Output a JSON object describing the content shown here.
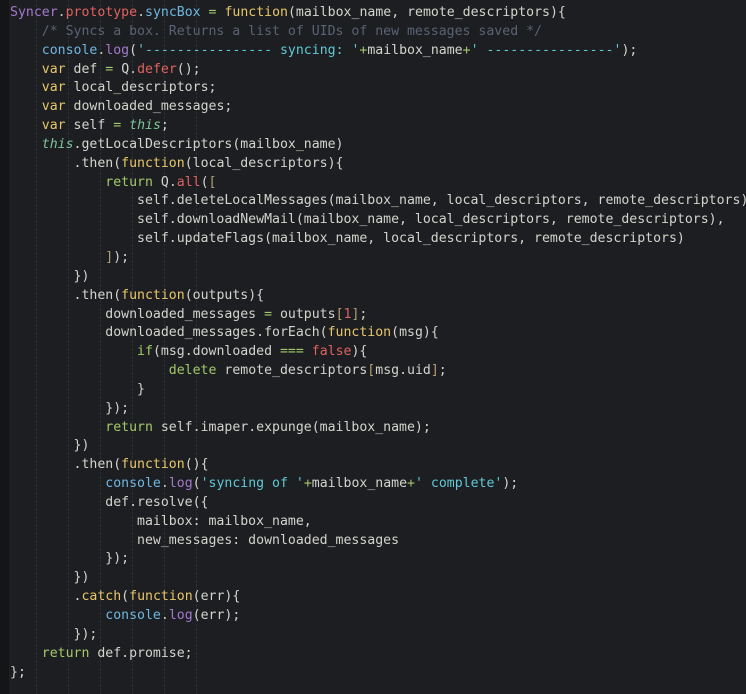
{
  "editor": {
    "language": "javascript",
    "theme_name": "dark",
    "colors": {
      "background": "#1c1e21",
      "gutter": "#141517",
      "default_text": "#d4d4cd",
      "class_name": "#a37acc",
      "property": "#e0625f",
      "function_name": "#6fb7e0",
      "keyword": "#e8c76a",
      "operator": "#a3c96a",
      "this_keyword": "#7ec699",
      "string": "#5fc9d6",
      "comment": "#5a6374",
      "number": "#e0625f",
      "bracket": "#b5a070"
    },
    "total_lines": 37
  },
  "code_lines": [
    {
      "n": 1,
      "tokens": [
        {
          "t": "Syncer",
          "c": "t-cls"
        },
        {
          "t": ".",
          "c": "t-pun"
        },
        {
          "t": "prototype",
          "c": "t-prop"
        },
        {
          "t": ".",
          "c": "t-pun"
        },
        {
          "t": "syncBox",
          "c": "t-fn"
        },
        {
          "t": " ",
          "c": "t-def"
        },
        {
          "t": "=",
          "c": "t-op"
        },
        {
          "t": " ",
          "c": "t-def"
        },
        {
          "t": "function",
          "c": "t-kw"
        },
        {
          "t": "(mailbox_name, remote_descriptors){",
          "c": "t-def"
        }
      ]
    },
    {
      "n": 2,
      "tokens": [
        {
          "t": "    /* Syncs a box. Returns a list of UIDs of new messages saved */",
          "c": "t-com"
        }
      ]
    },
    {
      "n": 3,
      "tokens": [
        {
          "t": "    ",
          "c": "t-def"
        },
        {
          "t": "console",
          "c": "t-blue"
        },
        {
          "t": ".",
          "c": "t-pun"
        },
        {
          "t": "log",
          "c": "t-purp"
        },
        {
          "t": "(",
          "c": "t-def"
        },
        {
          "t": "'---------------- syncing: '",
          "c": "t-str"
        },
        {
          "t": "+",
          "c": "t-op"
        },
        {
          "t": "mailbox_name",
          "c": "t-def"
        },
        {
          "t": "+",
          "c": "t-op"
        },
        {
          "t": "' ----------------'",
          "c": "t-str"
        },
        {
          "t": ");",
          "c": "t-def"
        }
      ]
    },
    {
      "n": 4,
      "tokens": [
        {
          "t": "    ",
          "c": "t-def"
        },
        {
          "t": "var",
          "c": "t-kw"
        },
        {
          "t": " def ",
          "c": "t-def"
        },
        {
          "t": "=",
          "c": "t-op"
        },
        {
          "t": " Q",
          "c": "t-def"
        },
        {
          "t": ".",
          "c": "t-pun"
        },
        {
          "t": "defer",
          "c": "t-prop"
        },
        {
          "t": "();",
          "c": "t-def"
        }
      ]
    },
    {
      "n": 5,
      "tokens": [
        {
          "t": "    ",
          "c": "t-def"
        },
        {
          "t": "var",
          "c": "t-kw"
        },
        {
          "t": " local_descriptors;",
          "c": "t-def"
        }
      ]
    },
    {
      "n": 6,
      "tokens": [
        {
          "t": "    ",
          "c": "t-def"
        },
        {
          "t": "var",
          "c": "t-kw"
        },
        {
          "t": " downloaded_messages;",
          "c": "t-def"
        }
      ]
    },
    {
      "n": 7,
      "tokens": [
        {
          "t": "    ",
          "c": "t-def"
        },
        {
          "t": "var",
          "c": "t-kw"
        },
        {
          "t": " self ",
          "c": "t-def"
        },
        {
          "t": "=",
          "c": "t-op"
        },
        {
          "t": " ",
          "c": "t-def"
        },
        {
          "t": "this",
          "c": "t-this"
        },
        {
          "t": ";",
          "c": "t-def"
        }
      ]
    },
    {
      "n": 8,
      "tokens": [
        {
          "t": "    ",
          "c": "t-def"
        },
        {
          "t": "this",
          "c": "t-this"
        },
        {
          "t": ".getLocalDescriptors(mailbox_name)",
          "c": "t-def"
        }
      ]
    },
    {
      "n": 9,
      "tokens": [
        {
          "t": "        .then(",
          "c": "t-def"
        },
        {
          "t": "function",
          "c": "t-kw"
        },
        {
          "t": "(local_descriptors){",
          "c": "t-def"
        }
      ]
    },
    {
      "n": 10,
      "tokens": [
        {
          "t": "            ",
          "c": "t-def"
        },
        {
          "t": "return",
          "c": "t-ret"
        },
        {
          "t": " Q",
          "c": "t-def"
        },
        {
          "t": ".",
          "c": "t-pun"
        },
        {
          "t": "all",
          "c": "t-prop"
        },
        {
          "t": "(",
          "c": "t-def"
        },
        {
          "t": "[",
          "c": "t-brk"
        }
      ]
    },
    {
      "n": 11,
      "tokens": [
        {
          "t": "                self.deleteLocalMessages(mailbox_name, local_descriptors, remote_descriptors),",
          "c": "t-def"
        }
      ]
    },
    {
      "n": 12,
      "tokens": [
        {
          "t": "                self.downloadNewMail(mailbox_name, local_descriptors, remote_descriptors),",
          "c": "t-def"
        }
      ]
    },
    {
      "n": 13,
      "tokens": [
        {
          "t": "                self.updateFlags(mailbox_name, local_descriptors, remote_descriptors)",
          "c": "t-def"
        }
      ]
    },
    {
      "n": 14,
      "tokens": [
        {
          "t": "            ",
          "c": "t-def"
        },
        {
          "t": "]",
          "c": "t-brk"
        },
        {
          "t": ");",
          "c": "t-def"
        }
      ]
    },
    {
      "n": 15,
      "tokens": [
        {
          "t": "        })",
          "c": "t-def"
        }
      ]
    },
    {
      "n": 16,
      "tokens": [
        {
          "t": "        .then(",
          "c": "t-def"
        },
        {
          "t": "function",
          "c": "t-kw"
        },
        {
          "t": "(outputs){",
          "c": "t-def"
        }
      ]
    },
    {
      "n": 17,
      "tokens": [
        {
          "t": "            downloaded_messages ",
          "c": "t-def"
        },
        {
          "t": "=",
          "c": "t-op"
        },
        {
          "t": " outputs",
          "c": "t-def"
        },
        {
          "t": "[",
          "c": "t-brk"
        },
        {
          "t": "1",
          "c": "t-num"
        },
        {
          "t": "]",
          "c": "t-brk"
        },
        {
          "t": ";",
          "c": "t-def"
        }
      ]
    },
    {
      "n": 18,
      "tokens": [
        {
          "t": "            downloaded_messages.forEach(",
          "c": "t-def"
        },
        {
          "t": "function",
          "c": "t-kw"
        },
        {
          "t": "(msg){",
          "c": "t-def"
        }
      ]
    },
    {
      "n": 19,
      "tokens": [
        {
          "t": "                ",
          "c": "t-def"
        },
        {
          "t": "if",
          "c": "t-ret"
        },
        {
          "t": "(msg.downloaded ",
          "c": "t-def"
        },
        {
          "t": "===",
          "c": "t-op"
        },
        {
          "t": " ",
          "c": "t-def"
        },
        {
          "t": "false",
          "c": "t-num"
        },
        {
          "t": "){",
          "c": "t-def"
        }
      ]
    },
    {
      "n": 20,
      "tokens": [
        {
          "t": "                    ",
          "c": "t-def"
        },
        {
          "t": "delete",
          "c": "t-ret"
        },
        {
          "t": " remote_descriptors",
          "c": "t-def"
        },
        {
          "t": "[",
          "c": "t-brk"
        },
        {
          "t": "msg.uid",
          "c": "t-def"
        },
        {
          "t": "]",
          "c": "t-brk"
        },
        {
          "t": ";",
          "c": "t-def"
        }
      ]
    },
    {
      "n": 21,
      "tokens": [
        {
          "t": "                }",
          "c": "t-def"
        }
      ]
    },
    {
      "n": 22,
      "tokens": [
        {
          "t": "            });",
          "c": "t-def"
        }
      ]
    },
    {
      "n": 23,
      "tokens": [
        {
          "t": "            ",
          "c": "t-def"
        },
        {
          "t": "return",
          "c": "t-ret"
        },
        {
          "t": " self.imaper.expunge(mailbox_name);",
          "c": "t-def"
        }
      ]
    },
    {
      "n": 24,
      "tokens": [
        {
          "t": "        })",
          "c": "t-def"
        }
      ]
    },
    {
      "n": 25,
      "tokens": [
        {
          "t": "        .then(",
          "c": "t-def"
        },
        {
          "t": "function",
          "c": "t-kw"
        },
        {
          "t": "(){",
          "c": "t-def"
        }
      ]
    },
    {
      "n": 26,
      "tokens": [
        {
          "t": "            ",
          "c": "t-def"
        },
        {
          "t": "console",
          "c": "t-blue"
        },
        {
          "t": ".",
          "c": "t-pun"
        },
        {
          "t": "log",
          "c": "t-purp"
        },
        {
          "t": "(",
          "c": "t-def"
        },
        {
          "t": "'syncing of '",
          "c": "t-str"
        },
        {
          "t": "+",
          "c": "t-op"
        },
        {
          "t": "mailbox_name",
          "c": "t-def"
        },
        {
          "t": "+",
          "c": "t-op"
        },
        {
          "t": "' complete'",
          "c": "t-str"
        },
        {
          "t": ");",
          "c": "t-def"
        }
      ]
    },
    {
      "n": 27,
      "tokens": [
        {
          "t": "            def.resolve({",
          "c": "t-def"
        }
      ]
    },
    {
      "n": 28,
      "tokens": [
        {
          "t": "                mailbox: mailbox_name,",
          "c": "t-def"
        }
      ]
    },
    {
      "n": 29,
      "tokens": [
        {
          "t": "                new_messages: downloaded_messages",
          "c": "t-def"
        }
      ]
    },
    {
      "n": 30,
      "tokens": [
        {
          "t": "            });",
          "c": "t-def"
        }
      ]
    },
    {
      "n": 31,
      "tokens": [
        {
          "t": "        })",
          "c": "t-def"
        }
      ]
    },
    {
      "n": 32,
      "tokens": [
        {
          "t": "        .",
          "c": "t-def"
        },
        {
          "t": "catch",
          "c": "t-meth"
        },
        {
          "t": "(",
          "c": "t-def"
        },
        {
          "t": "function",
          "c": "t-kw"
        },
        {
          "t": "(err){",
          "c": "t-def"
        }
      ]
    },
    {
      "n": 33,
      "tokens": [
        {
          "t": "            ",
          "c": "t-def"
        },
        {
          "t": "console",
          "c": "t-blue"
        },
        {
          "t": ".",
          "c": "t-pun"
        },
        {
          "t": "log",
          "c": "t-purp"
        },
        {
          "t": "(err);",
          "c": "t-def"
        }
      ]
    },
    {
      "n": 34,
      "tokens": [
        {
          "t": "        });",
          "c": "t-def"
        }
      ]
    },
    {
      "n": 35,
      "tokens": [
        {
          "t": "    ",
          "c": "t-def"
        },
        {
          "t": "return",
          "c": "t-ret"
        },
        {
          "t": " def.promise;",
          "c": "t-def"
        }
      ]
    },
    {
      "n": 36,
      "tokens": [
        {
          "t": "};",
          "c": "t-def"
        }
      ]
    }
  ],
  "indent_guide_x": [
    36,
    68,
    100,
    132,
    164,
    196
  ]
}
